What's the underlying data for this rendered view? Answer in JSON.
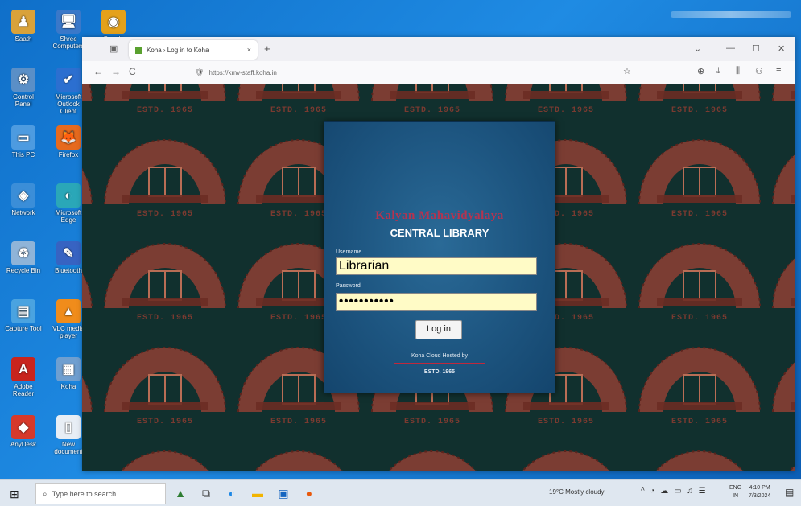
{
  "desktop": {
    "icons": [
      {
        "label": "Saath",
        "glyph": "♟",
        "color": "#d9a23a"
      },
      {
        "label": "Shree Computers",
        "glyph": "🖥",
        "color": "#3a78c9"
      },
      {
        "label": "Google Chrome",
        "glyph": "◉",
        "color": "#e4a11b"
      },
      {
        "label": "Control Panel",
        "glyph": "⚙",
        "color": "#5a8fc7"
      },
      {
        "label": "Microsoft Outlook Client",
        "glyph": "✔",
        "color": "#2c6fd0"
      },
      {
        "label": "This PC",
        "glyph": "▭",
        "color": "#4d9be0"
      },
      {
        "label": "Firefox",
        "glyph": "🦊",
        "color": "#e66a1e"
      },
      {
        "label": "Network",
        "glyph": "◈",
        "color": "#3b8ed8"
      },
      {
        "label": "Microsoft Edge",
        "glyph": "◐",
        "color": "#2aa7b8"
      },
      {
        "label": "Recycle Bin",
        "glyph": "♻",
        "color": "#8fb4d8"
      },
      {
        "label": "Bluetooth",
        "glyph": "✎",
        "color": "#3763c2"
      },
      {
        "label": "Capture Tool",
        "glyph": "▤",
        "color": "#4aa3e0"
      },
      {
        "label": "VLC media player",
        "glyph": "▲",
        "color": "#f08c1b"
      },
      {
        "label": "Adobe Reader",
        "glyph": "A",
        "color": "#c8241e"
      },
      {
        "label": "Koha",
        "glyph": "▦",
        "color": "#6f9fd0"
      },
      {
        "label": "AnyDesk",
        "glyph": "◆",
        "color": "#d6392b"
      },
      {
        "label": "New document",
        "glyph": "▯",
        "color": "#e8eef5"
      }
    ]
  },
  "browser": {
    "tab_title": "Koha › Log in to Koha",
    "tab_close": "×",
    "new_tab": "+",
    "url": "https://kmv-staff.koha.in",
    "nav": {
      "back": "←",
      "forward": "→",
      "reload": "C"
    },
    "window": {
      "minimize": "—",
      "maximize": "☐",
      "close": "✕",
      "chevron": "⌄"
    },
    "toolbar_icons": {
      "star": "☆",
      "pocket": "⊕",
      "download": "⤓",
      "library": "⫼",
      "account": "⚇",
      "menu": "≡"
    }
  },
  "login": {
    "college_name": "Kalyan Mahavidyalaya",
    "library_name": "CENTRAL LIBRARY",
    "username_label": "Username",
    "username_value": "Librarian",
    "password_label": "Password",
    "password_value": "•••••••••••",
    "login_button": "Log in",
    "hosted_by": "Koha Cloud Hosted by",
    "estd": "ESTD. 1965"
  },
  "background_tile": {
    "estd_text": "ESTD. 1965"
  },
  "taskbar": {
    "search_placeholder": "Type here to search",
    "weather": "19°C Mostly cloudy",
    "lang": "ENG\nIN",
    "time": "4:10 PM",
    "date": "7/3/2024"
  },
  "colors": {
    "panel": "#1d5580",
    "college": "#b43450",
    "field_bg": "#fffbc6",
    "brick": "#8e3f34"
  }
}
